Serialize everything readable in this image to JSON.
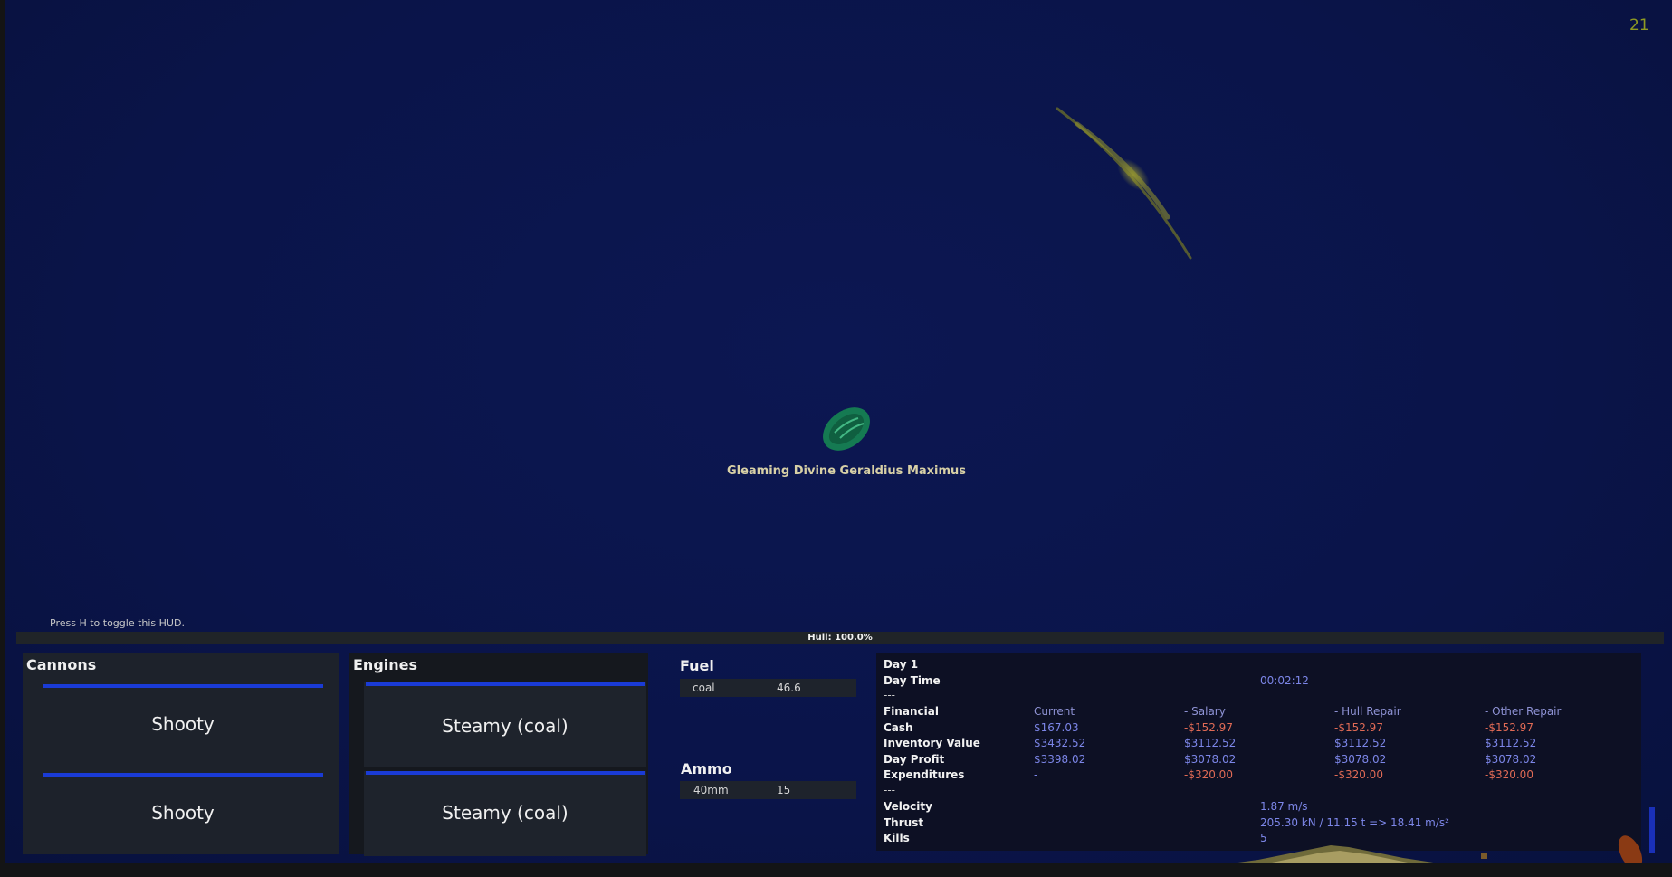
{
  "hud": {
    "fps": "21",
    "ship_name": "Gleaming Divine Geraldius Maximus",
    "toggle_hint": "Press H to toggle this HUD.",
    "hull": "Hull: 100.0%"
  },
  "cannons": {
    "title": "Cannons",
    "items": [
      {
        "label": "Shooty"
      },
      {
        "label": "Shooty"
      }
    ]
  },
  "engines": {
    "title": "Engines",
    "items": [
      {
        "label": "Steamy  (coal)"
      },
      {
        "label": "Steamy  (coal)"
      }
    ]
  },
  "fuel": {
    "title": "Fuel",
    "rows": [
      {
        "name": "coal",
        "amount": "46.6"
      }
    ]
  },
  "ammo": {
    "title": "Ammo",
    "rows": [
      {
        "name": "40mm",
        "amount": "15"
      }
    ]
  },
  "stats": {
    "day_label": "Day  1",
    "day_time_label": "Day Time",
    "day_time_value": "00:02:12",
    "separator": "---",
    "financial_label": "Financial",
    "columns": [
      "Current",
      "- Salary",
      "- Hull Repair",
      "- Other Repair"
    ],
    "rows": [
      {
        "label": "Cash",
        "values": [
          "$167.03",
          "-$152.97",
          "-$152.97",
          "-$152.97"
        ]
      },
      {
        "label": "Inventory Value",
        "values": [
          "$3432.52",
          "$3112.52",
          "$3112.52",
          "$3112.52"
        ]
      },
      {
        "label": "Day Profit",
        "values": [
          "$3398.02",
          "$3078.02",
          "$3078.02",
          "$3078.02"
        ]
      },
      {
        "label": "Expenditures",
        "values": [
          "-",
          "-$320.00",
          "-$320.00",
          "-$320.00"
        ]
      }
    ],
    "velocity_label": "Velocity",
    "velocity_value": "1.87 m/s",
    "thrust_label": "Thrust",
    "thrust_value": "205.30 kN  /  11.15 t  =>  18.41 m/s²",
    "kills_label": "Kills",
    "kills_value": "5"
  },
  "colors": {
    "sea": "#0a1449",
    "slot_bar": "#1a3bd6",
    "current_value": "#7c86e8",
    "negative_value": "#e06a55",
    "fps": "#8f9a22"
  }
}
